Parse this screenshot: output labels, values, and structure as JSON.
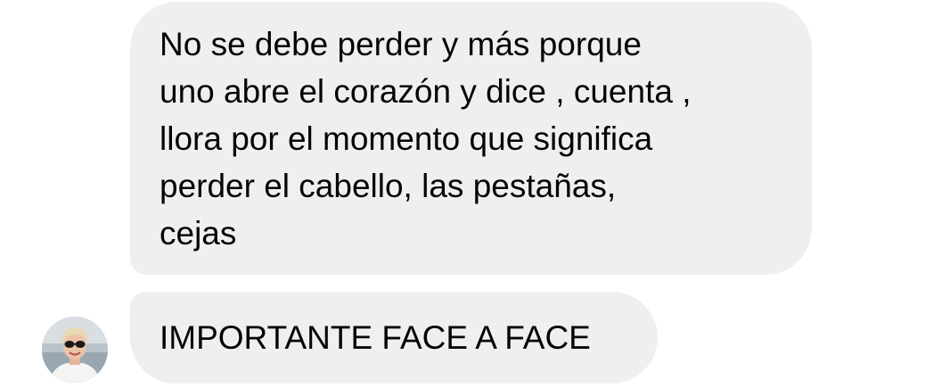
{
  "messages": [
    {
      "lines": [
        "No se debe perder y más porque",
        "uno abre el corazón y dice , cuenta ,",
        "llora por el momento que significa",
        "perder el cabello, las pestañas,",
        "cejas"
      ]
    },
    {
      "text": "IMPORTANTE FACE A FACE"
    }
  ],
  "colors": {
    "bubble_bg": "#efefef",
    "text": "#050505",
    "background": "#ffffff"
  },
  "avatar": {
    "icon": "user-avatar-photo"
  }
}
